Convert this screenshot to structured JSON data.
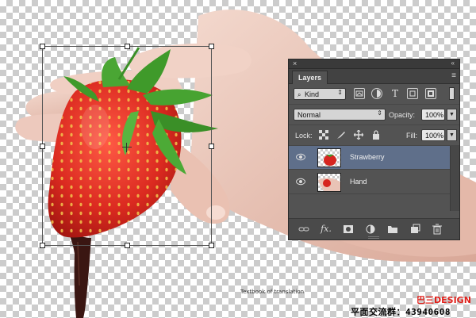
{
  "panel": {
    "close_glyph": "×",
    "collapse_glyph": "«",
    "tab_title": "Layers",
    "menu_glyph": "≡",
    "filter": {
      "label": "Kind",
      "icons": [
        "image-filter-icon",
        "adjustment-filter-icon",
        "type-filter-icon",
        "shape-filter-icon",
        "smart-object-filter-icon",
        "filter-toggle-icon"
      ]
    },
    "blend": {
      "mode": "Normal",
      "opacity_label": "Opacity:",
      "opacity_value": "100%"
    },
    "lock": {
      "label": "Lock:",
      "icons": [
        "lock-transparent-pixels-icon",
        "lock-image-pixels-icon",
        "lock-position-icon",
        "lock-all-icon"
      ],
      "fill_label": "Fill:",
      "fill_value": "100%"
    },
    "layers": [
      {
        "name": "Strawberry",
        "selected": true,
        "visible": true
      },
      {
        "name": "Hand",
        "selected": false,
        "visible": true
      }
    ],
    "footer_icons": [
      "link-layers-icon",
      "fx-icon",
      "layer-mask-icon",
      "adjustment-layer-icon",
      "group-folder-icon",
      "new-layer-icon",
      "trash-icon"
    ],
    "selection_color": "#5f6f8a"
  },
  "watermark": {
    "caption": "Textbook of translation",
    "brand": "巴三DESIGN",
    "qq_group": "平面交流群：43940608"
  },
  "colors": {
    "strawberry": "#d6251f",
    "leaves": "#3f9a2a",
    "chocolate": "#3a1612",
    "skin": "#e9c3b6",
    "panel_bg": "#535353",
    "brand_red": "#e0201a"
  }
}
